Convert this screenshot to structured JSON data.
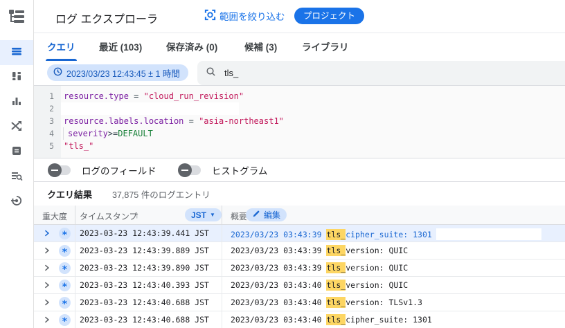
{
  "colors": {
    "accent_blue": "#1a73e8",
    "link_blue": "#1967d2",
    "chip_blue_bg": "#d2e3fc",
    "selected_row_bg": "#e8f0fe",
    "match_yellow": "#fdd663",
    "code_field_purple": "#7b1fa2",
    "code_string_pink": "#c2185b",
    "code_keyword_green": "#188038"
  },
  "icons": {
    "severity_default": "∗",
    "sort_ascending": "↑",
    "dropdown_arrow": "▼"
  },
  "header": {
    "title": "ログ エクスプローラ",
    "refine_scope_label": "範囲を絞り込む",
    "project_badge": "プロジェクト"
  },
  "tabs": [
    {
      "label": "クエリ",
      "active": true
    },
    {
      "label": "最近 (103)",
      "active": false
    },
    {
      "label": "保存済み (0)",
      "active": false
    },
    {
      "label": "候補 (3)",
      "active": false
    },
    {
      "label": "ライブラリ",
      "active": false
    }
  ],
  "query_bar": {
    "time_range": "2023/03/23 12:43:45 ± 1 時間",
    "search_value": "tls_"
  },
  "editor": {
    "lines": [
      {
        "num": "1",
        "tokens": [
          [
            "field",
            "resource.type"
          ],
          [
            "op",
            " = "
          ],
          [
            "string",
            "\"cloud_run_revision\""
          ]
        ]
      },
      {
        "num": "2",
        "highlight": true,
        "tokens": []
      },
      {
        "num": "3",
        "tokens": [
          [
            "field",
            "resource.labels.location"
          ],
          [
            "op",
            " = "
          ],
          [
            "string",
            "\"asia-northeast1\""
          ]
        ]
      },
      {
        "num": "4",
        "guide": true,
        "tokens": [
          [
            "field",
            "severity"
          ],
          [
            "op",
            ">="
          ],
          [
            "keyword",
            "DEFAULT"
          ]
        ]
      },
      {
        "num": "5",
        "tokens": [
          [
            "string",
            "\"tls_\""
          ]
        ]
      }
    ]
  },
  "toggles": [
    {
      "label": "ログのフィールド",
      "on": false
    },
    {
      "label": "ヒストグラム",
      "on": false
    }
  ],
  "results": {
    "title": "クエリ結果",
    "count": "37,875 件のログエントリ"
  },
  "table": {
    "headers": {
      "severity": "重大度",
      "timestamp": "タイムスタンプ",
      "timezone": "JST",
      "summary": "概要",
      "edit": "編集"
    },
    "rows": [
      {
        "selected": true,
        "timestamp": "2023-03-23 12:43:39.441 JST",
        "time": "2023/03/23 03:43:39 ",
        "match": "tls_",
        "rest": "cipher_suite: 1301"
      },
      {
        "selected": false,
        "timestamp": "2023-03-23 12:43:39.889 JST",
        "time": "2023/03/23 03:43:39 ",
        "match": "tls_",
        "rest": "version: QUIC"
      },
      {
        "selected": false,
        "timestamp": "2023-03-23 12:43:39.890 JST",
        "time": "2023/03/23 03:43:39 ",
        "match": "tls_",
        "rest": "version: QUIC"
      },
      {
        "selected": false,
        "timestamp": "2023-03-23 12:43:40.393 JST",
        "time": "2023/03/23 03:43:40 ",
        "match": "tls_",
        "rest": "version: QUIC"
      },
      {
        "selected": false,
        "timestamp": "2023-03-23 12:43:40.688 JST",
        "time": "2023/03/23 03:43:40 ",
        "match": "tls_",
        "rest": "version: TLSv1.3"
      },
      {
        "selected": false,
        "timestamp": "2023-03-23 12:43:40.688 JST",
        "time": "2023/03/23 03:43:40 ",
        "match": "tls_",
        "rest": "cipher_suite: 1301"
      }
    ]
  }
}
